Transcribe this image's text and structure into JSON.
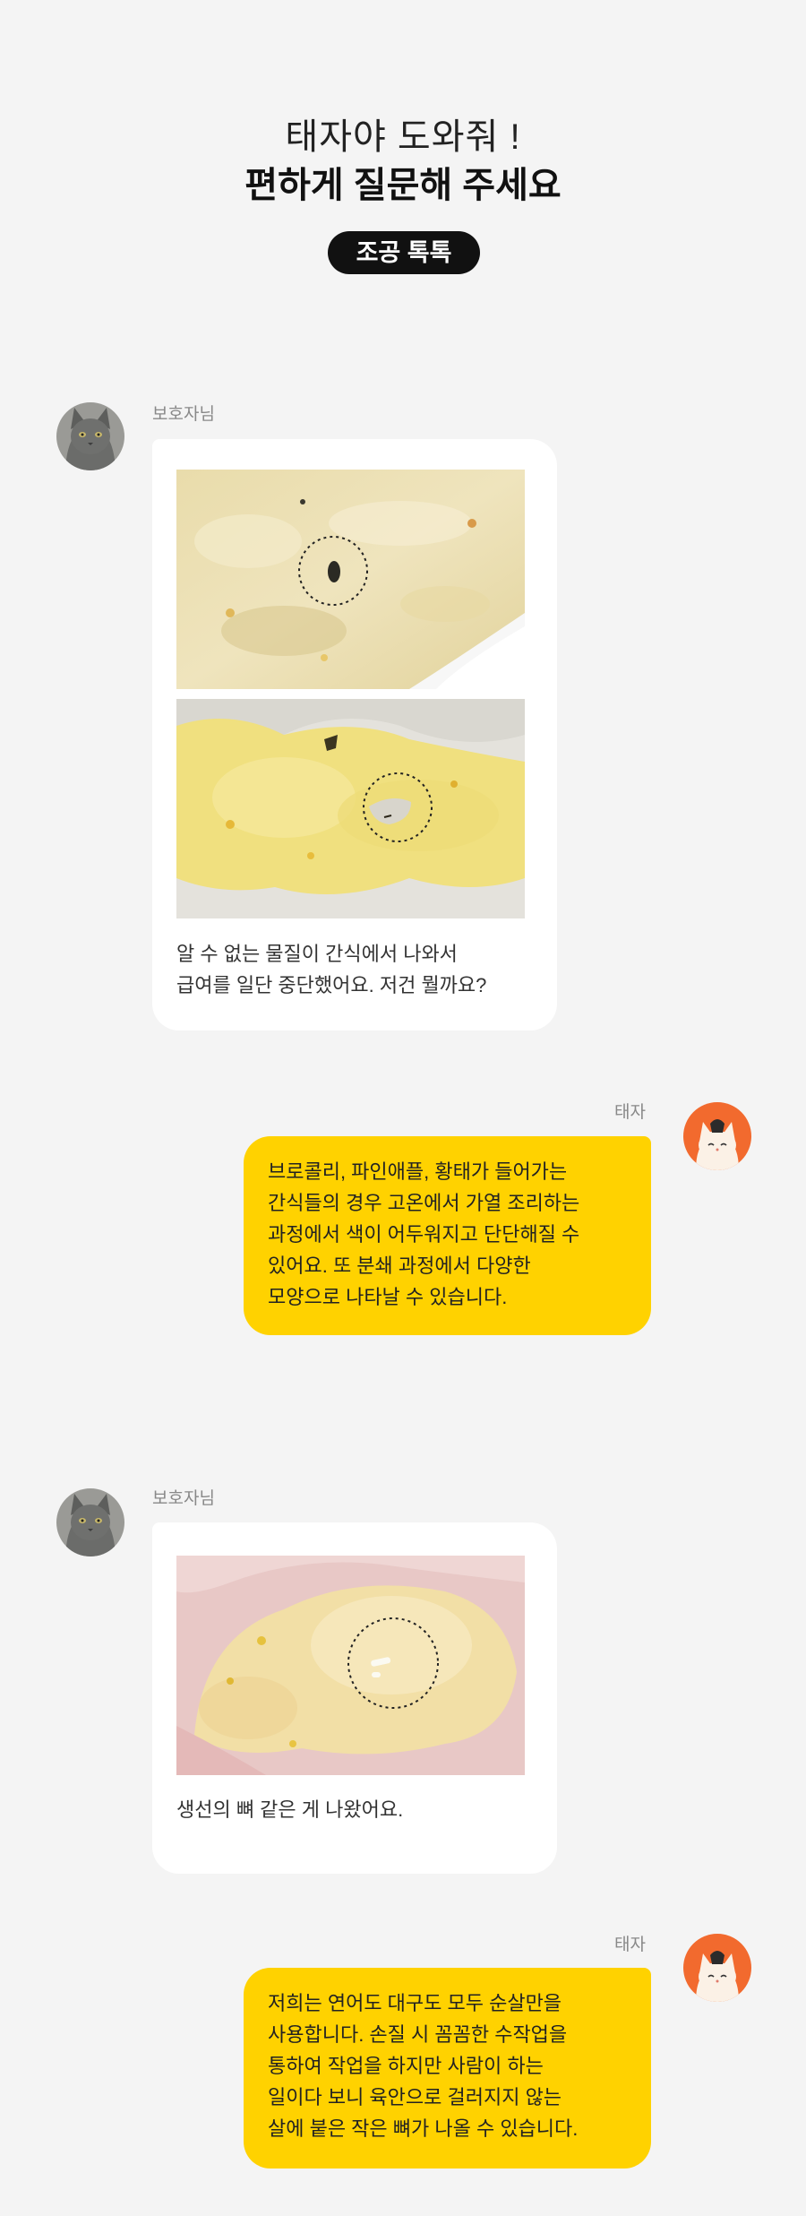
{
  "header": {
    "title_line1": "태자야 도와줘 !",
    "title_line2": "편하게 질문해 주세요",
    "badge": "조공 톡톡"
  },
  "conversation": [
    {
      "sender": "보호자님",
      "text": "알 수 없는 물질이 간식에서 나와서\n급여를 일단 중단했어요. 저건 뭘까요?",
      "photos": [
        "photo-treat-dark-speck",
        "photo-treat-hole"
      ]
    },
    {
      "sender": "태자",
      "text": "브로콜리, 파인애플, 황태가 들어가는\n간식들의 경우 고온에서 가열 조리하는\n과정에서 색이 어두워지고 단단해질 수\n있어요. 또 분쇄 과정에서 다양한\n모양으로 나타날 수 있습니다."
    },
    {
      "sender": "보호자님",
      "text": "생선의 뼈 같은 게 나왔어요.",
      "photos": [
        "photo-treat-bone"
      ]
    },
    {
      "sender": "태자",
      "text": "저희는 연어도 대구도 모두 순살만을\n사용합니다. 손질 시 꼼꼼한 수작업을\n통하여 작업을 하지만 사람이 하는\n일이다  보니 육안으로 걸러지지 않는\n살에 붙은  작은 뼈가 나올 수 있습니다."
    }
  ],
  "colors": {
    "background": "#f4f4f4",
    "reply_bubble": "#ffd200",
    "customer_bubble": "#ffffff",
    "badge": "#111111",
    "brand_avatar": "#f26a2e"
  }
}
